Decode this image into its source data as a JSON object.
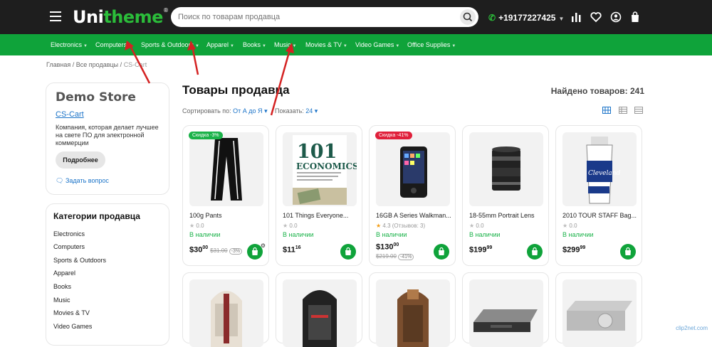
{
  "header": {
    "logo_main": "Uni",
    "logo_rest": "theme",
    "search_placeholder": "Поиск по товарам продавца",
    "phone": "+19177227425"
  },
  "nav": {
    "items": [
      "Electronics",
      "Computers",
      "Sports & Outdoors",
      "Apparel",
      "Books",
      "Music",
      "Movies & TV",
      "Video Games",
      "Office Supplies"
    ]
  },
  "breadcrumb": {
    "home": "Главная",
    "sellers": "Все продавцы",
    "current": "CS-Cart"
  },
  "store": {
    "name": "Demo Store",
    "link": "CS-Cart",
    "description": "Компания, которая делает лучшее на свете ПО для электронной коммерции",
    "more_button": "Подробнее",
    "ask": "Задать вопрос"
  },
  "categories": {
    "title": "Категории продавца",
    "items": [
      "Electronics",
      "Computers",
      "Sports & Outdoors",
      "Apparel",
      "Books",
      "Music",
      "Movies & TV",
      "Video Games"
    ]
  },
  "main": {
    "title": "Товары продавца",
    "found": "Найдено товаров: 241",
    "sort_label": "Сортировать по:",
    "sort_value": "От А до Я",
    "show_label": "Показать:",
    "show_value": "24"
  },
  "products": [
    {
      "badge": "Скидка -3%",
      "badge_color": "green",
      "name": "100g Pants",
      "rating": "0.0",
      "stock": "В наличии",
      "price": "$30",
      "cents": "00",
      "old": "$31.00",
      "off": "-3%"
    },
    {
      "badge": "",
      "name": "101 Things Everyone...",
      "rating": "0.0",
      "stock": "В наличии",
      "price": "$11",
      "cents": "16",
      "old": "",
      "off": ""
    },
    {
      "badge": "Скидка -41%",
      "badge_color": "red",
      "name": "16GB A Series Walkman...",
      "rating": "4.3 (Отзывов: 3)",
      "stock": "В наличии",
      "price": "$130",
      "cents": "00",
      "old": "$219.00",
      "off": "-41%"
    },
    {
      "badge": "",
      "name": "18-55mm Portrait Lens",
      "rating": "0.0",
      "stock": "В наличии",
      "price": "$199",
      "cents": "99",
      "old": "",
      "off": ""
    },
    {
      "badge": "",
      "name": "2010 TOUR STAFF Bag...",
      "rating": "0.0",
      "stock": "В наличии",
      "price": "$299",
      "cents": "99",
      "old": "",
      "off": ""
    }
  ],
  "book_cover": {
    "big": "101",
    "word": "ECONOMICS"
  },
  "golf_brand": "Cleveland",
  "watermark": "clip2net.com",
  "colors": {
    "green": "#0fa33a",
    "header": "#1e1e1e",
    "link": "#1a73c8",
    "sale_red": "#e0203b"
  }
}
